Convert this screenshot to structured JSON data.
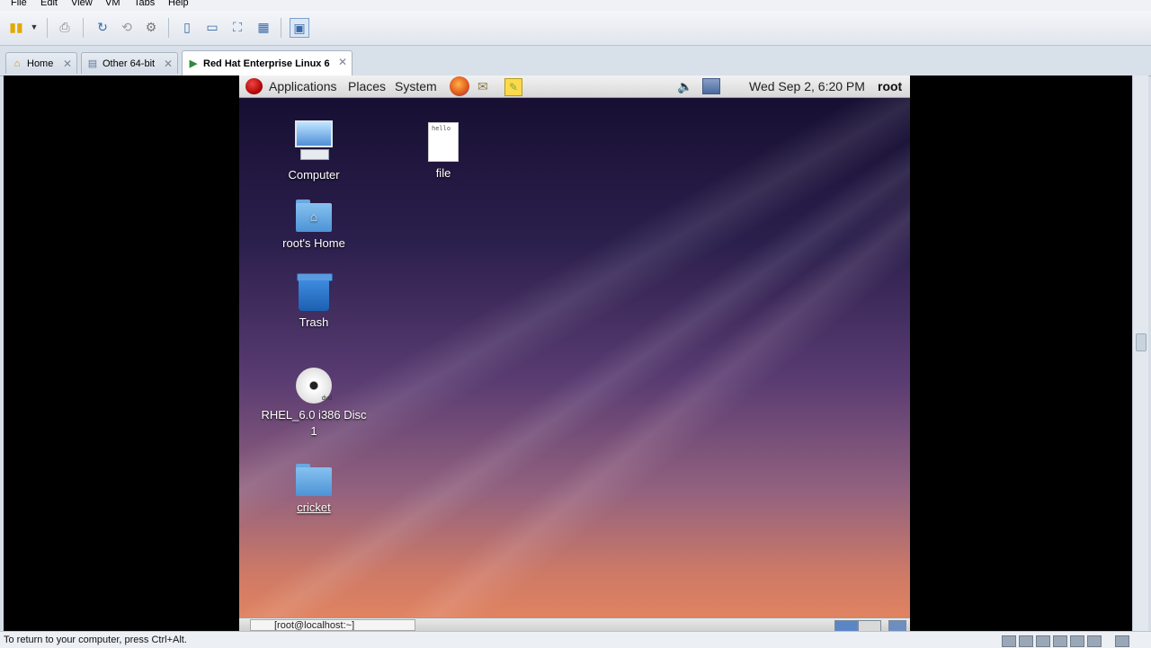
{
  "menubar": {
    "items": [
      "File",
      "Edit",
      "View",
      "VM",
      "Tabs",
      "Help"
    ]
  },
  "toolbar": {
    "buttons": [
      "power-icon",
      "dropdown-icon",
      "print-icon",
      "snapshot-icon",
      "revert-icon",
      "manage-snapshots-icon",
      "sidebar-icon",
      "console-view-icon",
      "fullscreen-icon",
      "unity-icon",
      "thumbnail-icon"
    ]
  },
  "tabs": [
    {
      "label": "Home",
      "icon": "home-icon",
      "active": false
    },
    {
      "label": "Other 64-bit",
      "icon": "vm-icon",
      "active": false
    },
    {
      "label": "Red Hat Enterprise Linux 6",
      "icon": "vm-icon",
      "active": true
    }
  ],
  "guest": {
    "panel": {
      "menus": [
        "Applications",
        "Places",
        "System"
      ],
      "clock": "Wed Sep  2,  6:20 PM",
      "user": "root"
    },
    "desktop_icons": [
      {
        "label": "Computer",
        "type": "computer"
      },
      {
        "label": "root's Home",
        "type": "home-folder"
      },
      {
        "label": "Trash",
        "type": "trash"
      },
      {
        "label": "RHEL_6.0 i386 Disc 1",
        "type": "dvd"
      },
      {
        "label": "cricket",
        "type": "folder"
      },
      {
        "label": "file",
        "type": "text-file",
        "preview": "hello"
      }
    ],
    "taskbar": {
      "task_label": "[root@localhost:~]"
    }
  },
  "statusbar": {
    "message": "To return to your computer, press Ctrl+Alt."
  },
  "colors": {
    "panel": "#e4e4e4",
    "accent": "#3b6aa8",
    "desktop_top": "#140d2e",
    "desktop_bottom": "#e5865f"
  }
}
